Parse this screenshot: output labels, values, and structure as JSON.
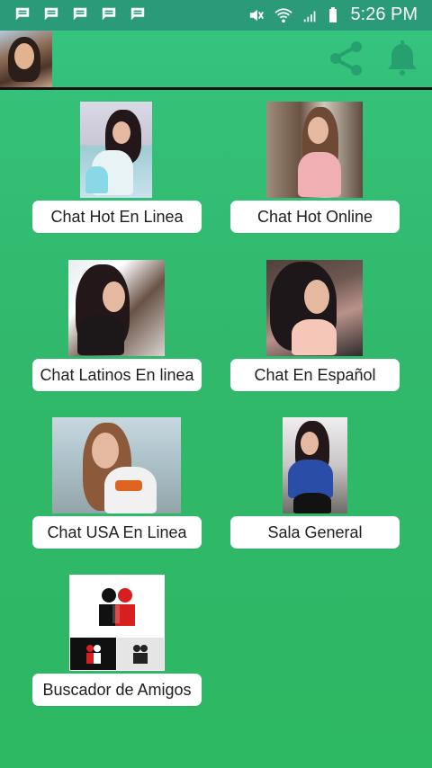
{
  "status_bar": {
    "time": "5:26 PM",
    "icons": [
      "message-icon",
      "message-icon",
      "message-icon",
      "message-icon",
      "message-icon",
      "mute-icon",
      "wifi-icon",
      "signal-icon",
      "battery-icon"
    ]
  },
  "app_bar": {
    "avatar": "profile-avatar",
    "actions": [
      "share-icon",
      "bell-icon"
    ]
  },
  "grid": [
    {
      "label": "Chat Hot En Linea",
      "image": "girl-selfie-pink-top"
    },
    {
      "label": "Chat Hot Online",
      "image": "girl-smiling-cafe"
    },
    {
      "label": "Chat Latinos En linea",
      "image": "girl-dark-hair-selfie"
    },
    {
      "label": "Chat En Español",
      "image": "girl-hand-on-face"
    },
    {
      "label": "Chat USA En Linea",
      "image": "girl-smiling-white-top"
    },
    {
      "label": "Sala General",
      "image": "girl-mirror-selfie-jersey"
    },
    {
      "label": "Buscador de Amigos",
      "image": "friends-icons-red-black"
    }
  ],
  "colors": {
    "background": "#31b86c",
    "status_bar": "#2a9a78",
    "card": "#ffffff",
    "text": "#202020"
  }
}
